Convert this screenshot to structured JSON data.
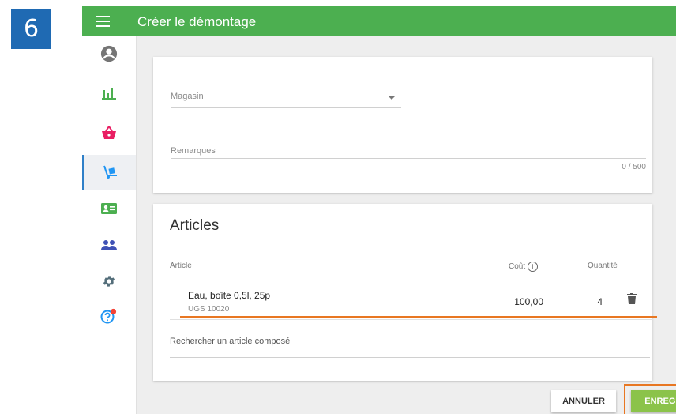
{
  "step_badge": "6",
  "appbar": {
    "title": "Créer le démontage",
    "menu_icon": "menu-icon"
  },
  "sidebar": {
    "items": [
      {
        "icon": "account-circle-icon",
        "color": "#757575"
      },
      {
        "icon": "bar-chart-icon",
        "color": "#4caf50"
      },
      {
        "icon": "basket-icon",
        "color": "#e91e63"
      },
      {
        "icon": "hand-truck-icon",
        "color": "#2196f3",
        "active": true
      },
      {
        "icon": "contact-card-icon",
        "color": "#4caf50"
      },
      {
        "icon": "people-icon",
        "color": "#3f51b5"
      },
      {
        "icon": "gear-icon",
        "color": "#546e7a"
      },
      {
        "icon": "help-icon",
        "color": "#2196f3",
        "badge_color": "#f44336"
      }
    ]
  },
  "form": {
    "store_label": "Magasin",
    "remarks_label": "Remarques",
    "remarks_counter": "0 / 500"
  },
  "articles": {
    "title": "Articles",
    "headers": {
      "article": "Article",
      "cost": "Coût",
      "quantity": "Quantité"
    },
    "rows": [
      {
        "name": "Eau, boîte 0,5l, 25p",
        "sku": "UGS 10020",
        "cost": "100,00",
        "quantity": "4"
      }
    ],
    "search_placeholder": "Rechercher un article composé"
  },
  "buttons": {
    "cancel": "ANNULER",
    "save": "ENREGISTRER"
  },
  "colors": {
    "appbar": "#4caf50",
    "save": "#8bc34a",
    "highlight": "#e87722",
    "badge": "#1f6ab3"
  }
}
